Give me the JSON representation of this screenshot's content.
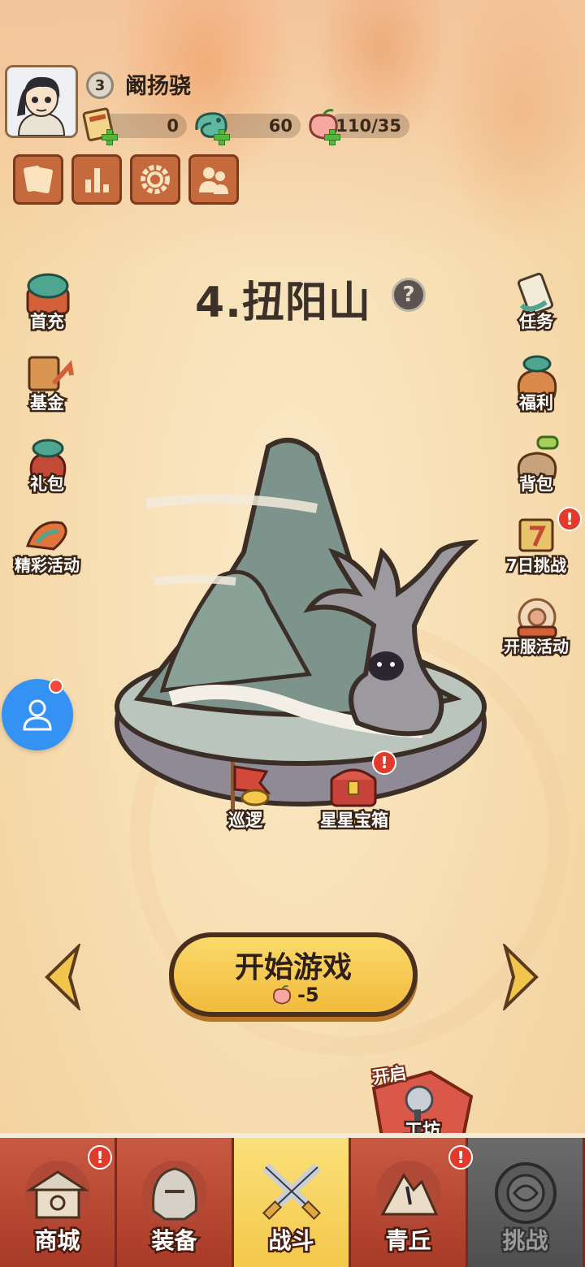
{
  "player": {
    "level": "3",
    "name": "阚扬骁",
    "resources": [
      {
        "icon": "ticket-icon",
        "value": "0"
      },
      {
        "icon": "jade-dragon-icon",
        "value": "60"
      },
      {
        "icon": "peach-stamina-icon",
        "value": "110/35"
      }
    ]
  },
  "top_buttons": [
    "cards-icon",
    "ranking-icon",
    "settings-gear-icon",
    "friends-icon"
  ],
  "stage": {
    "title": "4.扭阳山",
    "help": "?"
  },
  "left_menu": [
    {
      "label": "首充"
    },
    {
      "label": "基金"
    },
    {
      "label": "礼包"
    },
    {
      "label": "精彩活动"
    }
  ],
  "right_menu": [
    {
      "label": "任务"
    },
    {
      "label": "福利"
    },
    {
      "label": "背包"
    },
    {
      "label": "7日挑战",
      "alert": "!"
    },
    {
      "label": "开服活动"
    }
  ],
  "stage_items": [
    {
      "label": "巡逻"
    },
    {
      "label": "星星宝箱",
      "alert": "!"
    }
  ],
  "start": {
    "label": "开始游戏",
    "cost": "-5"
  },
  "workshop": {
    "tag": "开启",
    "label": "工坊"
  },
  "bottom_nav": [
    {
      "label": "商城",
      "alert": "!"
    },
    {
      "label": "装备"
    },
    {
      "label": "战斗"
    },
    {
      "label": "青丘",
      "alert": "!"
    },
    {
      "label": "挑战"
    }
  ],
  "colors": {
    "accent_yellow": "#f1bb3c",
    "nav_red": "#b3422f",
    "alert_red": "#e23b2c",
    "service_blue": "#3592f5"
  }
}
